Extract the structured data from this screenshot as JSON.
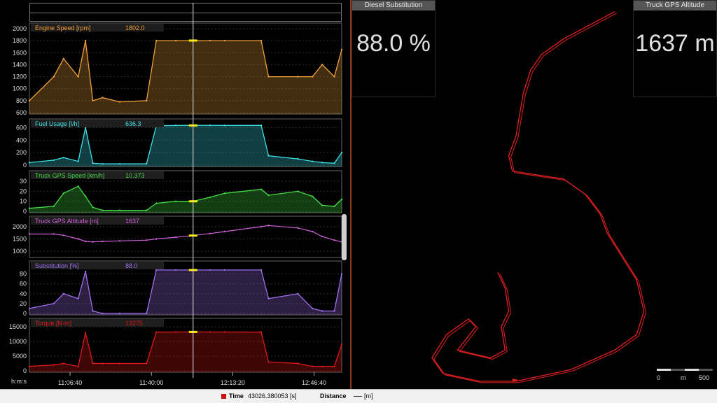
{
  "status_bar": {
    "time_label": "Time",
    "time_value": "43026.380053 [s]",
    "distance_label": "Distance",
    "distance_unit": "[m]"
  },
  "tiles": [
    {
      "title": "Diesel Substitution",
      "value": "88.0 %"
    },
    {
      "title": "Truck GPS Altitude",
      "value": "1637 m"
    }
  ],
  "scale_bar": {
    "start": "0",
    "unit": "m",
    "end": "500"
  },
  "time_axis": {
    "format_label": "h:m:s",
    "ticks": [
      "11:06:40",
      "11:40:00",
      "12:13:20",
      "12:46:40"
    ]
  },
  "cursor_time": "11:57:06",
  "colors": {
    "engine_speed": "#f2a13a",
    "fuel_usage": "#3ee0e8",
    "gps_speed": "#44dd44",
    "altitude": "#d060d8",
    "substitution": "#a070ee",
    "torque": "#e01818",
    "track": "#e02020"
  },
  "chart_data": [
    {
      "type": "line",
      "name": "Engine Speed [rpm]",
      "readout": "1802.0",
      "ylim": [
        600,
        2000
      ],
      "yticks": [
        "2000",
        "1800",
        "1600",
        "1400",
        "1200",
        "1000",
        "800",
        "600"
      ],
      "x": [
        "10:50",
        "11:00",
        "11:04",
        "11:10",
        "11:13",
        "11:16",
        "11:20",
        "11:27",
        "11:38",
        "11:42",
        "11:50",
        "11:57",
        "12:04",
        "12:10",
        "12:25",
        "12:28",
        "12:40",
        "12:46",
        "12:50",
        "12:55",
        "12:58"
      ],
      "values": [
        800,
        1200,
        1500,
        1200,
        1800,
        800,
        850,
        780,
        800,
        1800,
        1800,
        1802,
        1800,
        1800,
        1800,
        1200,
        1200,
        1200,
        1400,
        1200,
        1650
      ]
    },
    {
      "type": "line",
      "name": "Fuel Usage [l/h]",
      "readout": "636.3",
      "ylim": [
        0,
        650
      ],
      "yticks": [
        "600",
        "400",
        "200",
        "0"
      ],
      "x": [
        "10:50",
        "11:00",
        "11:04",
        "11:10",
        "11:13",
        "11:16",
        "11:20",
        "11:27",
        "11:38",
        "11:42",
        "11:50",
        "11:57",
        "12:04",
        "12:10",
        "12:25",
        "12:28",
        "12:40",
        "12:46",
        "12:50",
        "12:55",
        "12:58"
      ],
      "values": [
        40,
        80,
        120,
        60,
        600,
        30,
        20,
        20,
        20,
        630,
        635,
        636,
        636,
        635,
        636,
        150,
        100,
        60,
        40,
        30,
        200
      ]
    },
    {
      "type": "line",
      "name": "Truck GPS Speed [km/h]",
      "readout": "10.373",
      "ylim": [
        0,
        35
      ],
      "yticks": [
        "30",
        "20",
        "10",
        "0"
      ],
      "x": [
        "10:50",
        "11:00",
        "11:04",
        "11:10",
        "11:13",
        "11:16",
        "11:20",
        "11:27",
        "11:38",
        "11:42",
        "11:50",
        "11:57",
        "12:04",
        "12:10",
        "12:25",
        "12:28",
        "12:40",
        "12:46",
        "12:50",
        "12:55",
        "12:58"
      ],
      "values": [
        3,
        5,
        18,
        25,
        15,
        4,
        1,
        1,
        1,
        8,
        10,
        10,
        14,
        18,
        22,
        16,
        20,
        15,
        6,
        5,
        12
      ]
    },
    {
      "type": "line",
      "name": "Truck GPS Altitude [m]",
      "readout": "1637",
      "ylim": [
        800,
        2200
      ],
      "yticks": [
        "2000",
        "1500",
        "1000"
      ],
      "x": [
        "10:50",
        "11:00",
        "11:04",
        "11:10",
        "11:13",
        "11:16",
        "11:20",
        "11:27",
        "11:38",
        "11:42",
        "11:50",
        "11:57",
        "12:04",
        "12:10",
        "12:25",
        "12:28",
        "12:40",
        "12:46",
        "12:50",
        "12:55",
        "12:58"
      ],
      "values": [
        1700,
        1700,
        1650,
        1500,
        1400,
        1380,
        1400,
        1420,
        1450,
        1500,
        1570,
        1637,
        1720,
        1800,
        2000,
        2050,
        1950,
        1800,
        1600,
        1450,
        1380
      ]
    },
    {
      "type": "line",
      "name": "Substitution [%]",
      "readout": "88.0",
      "ylim": [
        0,
        95
      ],
      "yticks": [
        "80",
        "60",
        "40",
        "20",
        "0"
      ],
      "x": [
        "10:50",
        "11:00",
        "11:04",
        "11:10",
        "11:13",
        "11:16",
        "11:20",
        "11:27",
        "11:38",
        "11:42",
        "11:50",
        "11:57",
        "12:04",
        "12:10",
        "12:25",
        "12:28",
        "12:40",
        "12:46",
        "12:50",
        "12:55",
        "12:58"
      ],
      "values": [
        10,
        20,
        40,
        30,
        85,
        5,
        0,
        0,
        0,
        88,
        88,
        88,
        88,
        88,
        88,
        30,
        40,
        10,
        5,
        5,
        80
      ]
    },
    {
      "type": "line",
      "name": "Torque [N·m]",
      "readout": "13275",
      "ylim": [
        0,
        16000
      ],
      "yticks": [
        "15000",
        "10000",
        "5000",
        "0"
      ],
      "x": [
        "10:50",
        "11:00",
        "11:04",
        "11:10",
        "11:13",
        "11:16",
        "11:20",
        "11:27",
        "11:38",
        "11:42",
        "11:50",
        "11:57",
        "12:04",
        "12:10",
        "12:25",
        "12:28",
        "12:40",
        "12:46",
        "12:50",
        "12:55",
        "12:58"
      ],
      "values": [
        1500,
        2000,
        2500,
        1500,
        13000,
        2500,
        2500,
        2500,
        2500,
        13200,
        13250,
        13275,
        13250,
        13250,
        13200,
        3000,
        2500,
        1500,
        1500,
        1500,
        9000
      ]
    }
  ],
  "gps_track": {
    "points": [
      [
        0.72,
        0.03
      ],
      [
        0.58,
        0.1
      ],
      [
        0.52,
        0.14
      ],
      [
        0.49,
        0.18
      ],
      [
        0.47,
        0.24
      ],
      [
        0.45,
        0.35
      ],
      [
        0.43,
        0.4
      ],
      [
        0.44,
        0.44
      ],
      [
        0.58,
        0.46
      ],
      [
        0.64,
        0.5
      ],
      [
        0.68,
        0.55
      ],
      [
        0.7,
        0.6
      ],
      [
        0.74,
        0.66
      ],
      [
        0.78,
        0.72
      ],
      [
        0.8,
        0.8
      ],
      [
        0.78,
        0.86
      ],
      [
        0.72,
        0.9
      ],
      [
        0.6,
        0.95
      ],
      [
        0.45,
        0.98
      ],
      [
        0.35,
        0.98
      ],
      [
        0.25,
        0.96
      ],
      [
        0.22,
        0.92
      ],
      [
        0.26,
        0.86
      ],
      [
        0.32,
        0.82
      ],
      [
        0.34,
        0.84
      ],
      [
        0.29,
        0.9
      ],
      [
        0.38,
        0.92
      ],
      [
        0.42,
        0.9
      ],
      [
        0.41,
        0.84
      ],
      [
        0.43,
        0.8
      ],
      [
        0.42,
        0.74
      ],
      [
        0.4,
        0.7
      ]
    ]
  }
}
